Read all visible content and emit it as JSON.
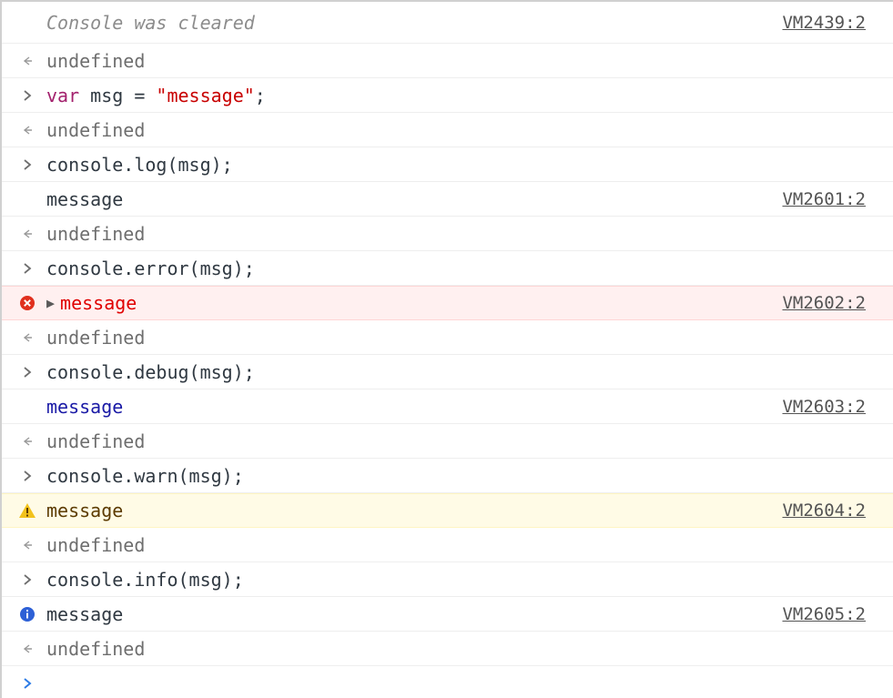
{
  "console": {
    "cleared": {
      "text": "Console was cleared",
      "source": "VM2439:2"
    },
    "result_1": "undefined",
    "input_1": {
      "keyword": "var",
      "rest_before": " msg = ",
      "string": "\"message\"",
      "rest_after": ";"
    },
    "result_2": "undefined",
    "input_2": "console.log(msg);",
    "log": {
      "text": "message",
      "source": "VM2601:2"
    },
    "result_3": "undefined",
    "input_3": "console.error(msg);",
    "error": {
      "text": "message",
      "source": "VM2602:2"
    },
    "result_4": "undefined",
    "input_4": "console.debug(msg);",
    "debug": {
      "text": "message",
      "source": "VM2603:2"
    },
    "result_5": "undefined",
    "input_5": "console.warn(msg);",
    "warning": {
      "text": "message",
      "source": "VM2604:2"
    },
    "result_6": "undefined",
    "input_6": "console.info(msg);",
    "info": {
      "text": "message",
      "source": "VM2605:2"
    },
    "result_7": "undefined"
  },
  "colors": {
    "error": "#e0301e",
    "warning": "#f2c21b",
    "info": "#2d60d6",
    "prompt": "#2d7be5"
  },
  "icons": {
    "input": "chevron-right-icon",
    "result": "return-arrow-icon",
    "error": "error-circle-icon",
    "warning": "warning-triangle-icon",
    "info": "info-circle-icon",
    "expand": "expand-triangle-icon",
    "prompt": "prompt-chevron-icon"
  }
}
